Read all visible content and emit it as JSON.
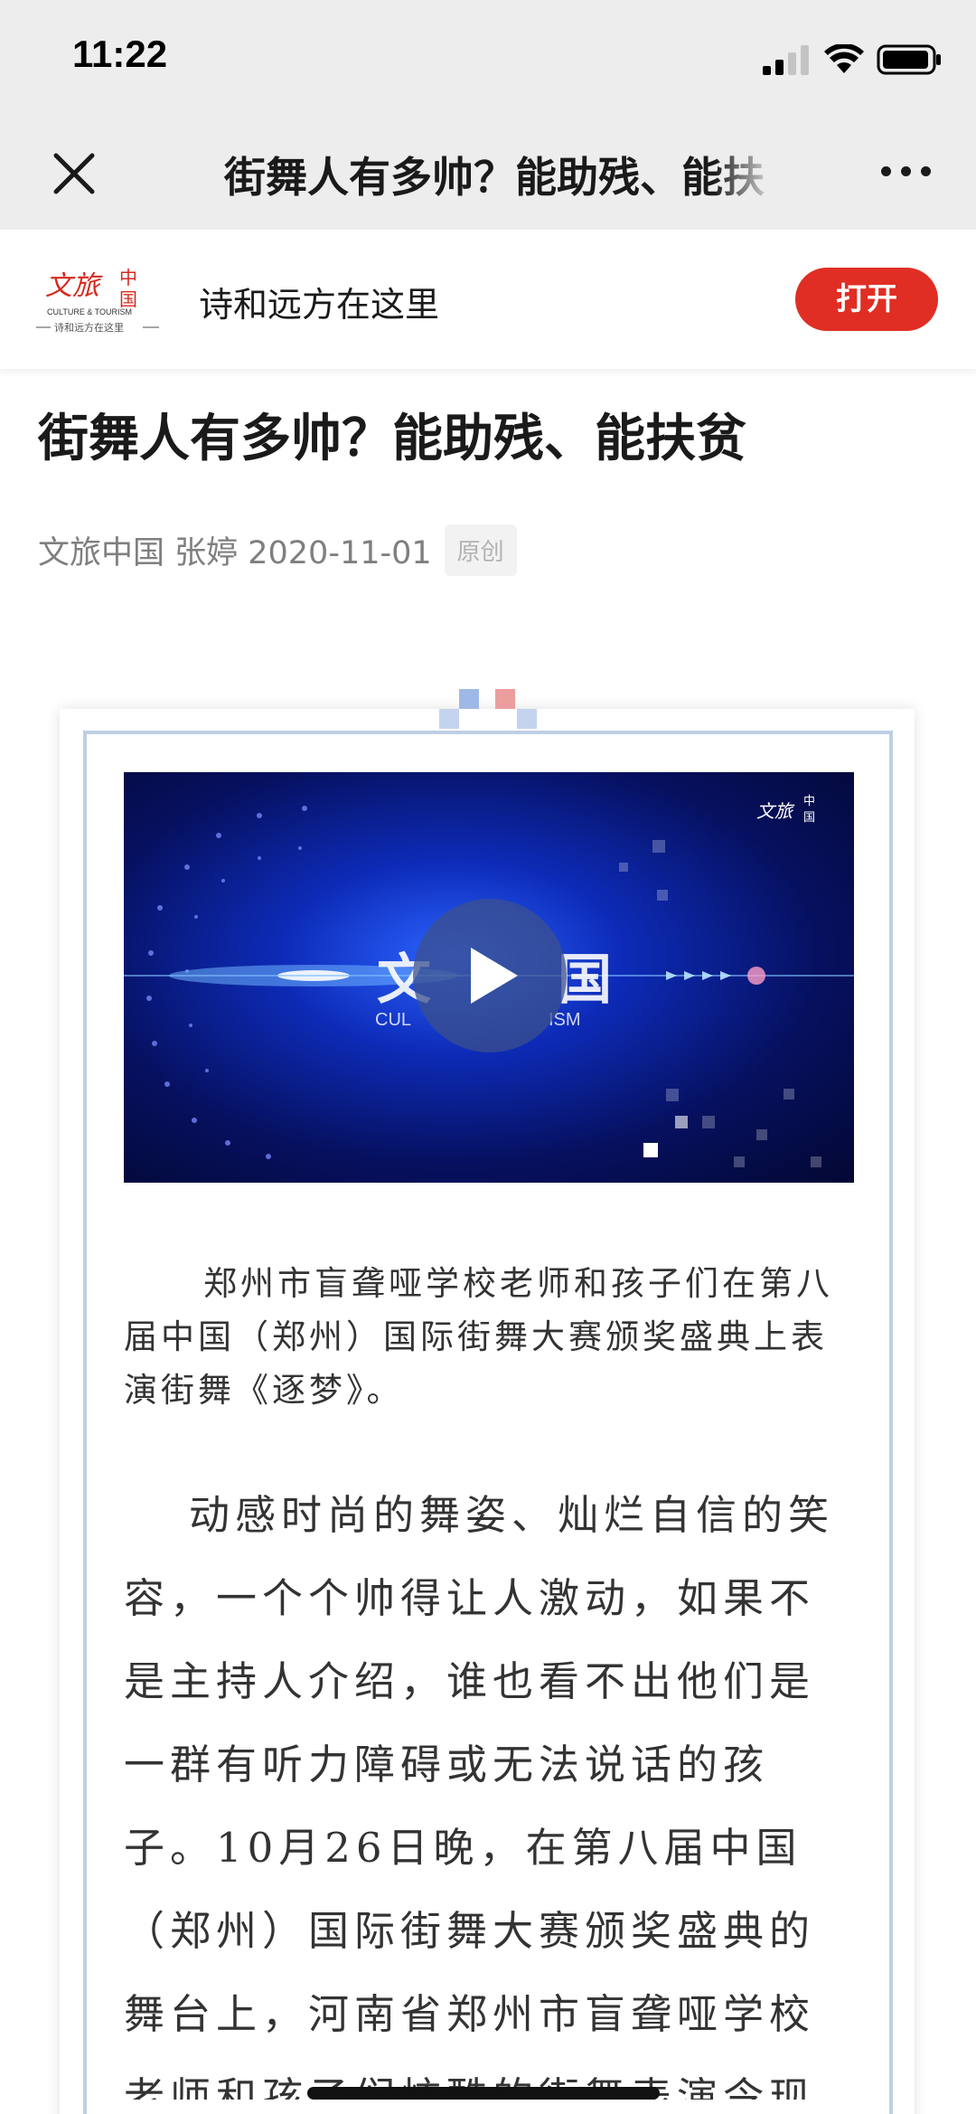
{
  "status_bar": {
    "time": "11:22"
  },
  "nav": {
    "title": "街舞人有多帅？能助残、能扶贫"
  },
  "account": {
    "name": "诗和远方在这里",
    "open_label": "打开",
    "logo_text": "文旅中国 CULTURE & TOURISM 诗和远方在这里"
  },
  "article": {
    "title": "街舞人有多帅？能助残、能扶贫",
    "meta": "文旅中国 张婷 2020-11-01",
    "tag": "原创",
    "video_caption": "郑州市盲聋哑学校老师和孩子们在第八届中国（郑州）国际街舞大赛颁奖盛典上表演街舞《逐梦》。",
    "paragraph": "动感时尚的舞姿、灿烂自信的笑容，一个个帅得让人激动，如果不是主持人介绍，谁也看不出他们是一群有听力障碍或无法说话的孩子。10月26日晚，在第八届中国（郑州）国际街舞大赛颁奖盛典的舞台上，河南省郑州市盲聋哑学校老师和孩子们炫酷的街舞表演令现场观众起立致敬"
  },
  "colors": {
    "accent": "#e02e24",
    "frame": "#bfcfe6"
  }
}
